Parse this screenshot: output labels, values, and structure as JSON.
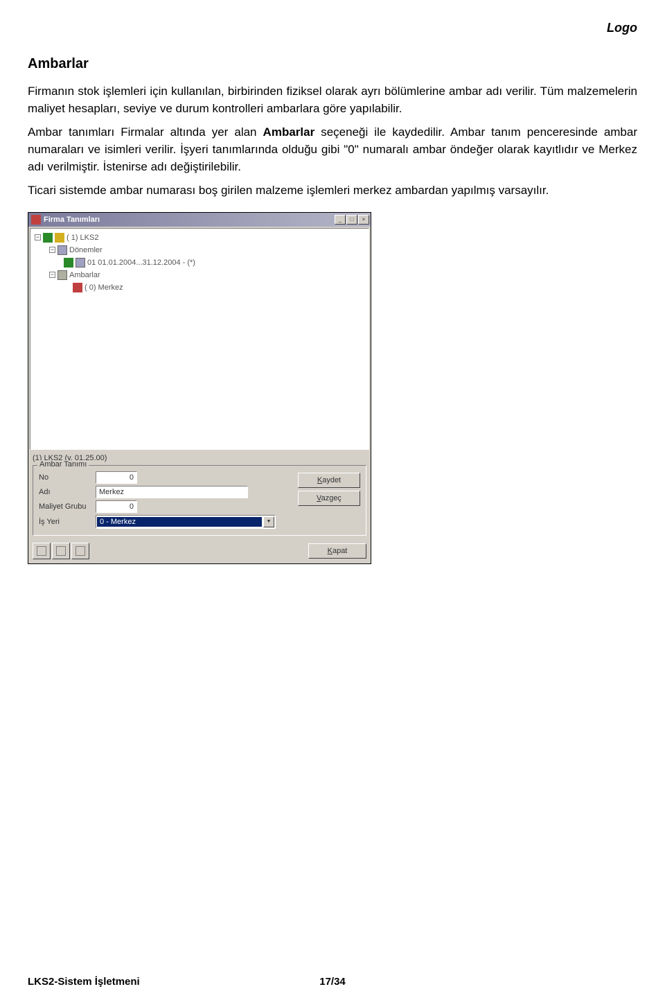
{
  "header": {
    "logo": "Logo"
  },
  "section": {
    "title": "Ambarlar",
    "p1a": "Firmanın stok işlemleri için kullanılan, birbirinden fiziksel olarak ayrı bölümlerine ambar adı verilir. Tüm malzemelerin maliyet hesapları, seviye ve durum kontrolleri ambarlara göre yapılabilir.",
    "p2a": "Ambar tanımları Firmalar altında yer alan ",
    "p2bold": "Ambarlar",
    "p2b": " seçeneği ile kaydedilir. Ambar tanım penceresinde ambar numaraları ve isimleri verilir. İşyeri tanımlarında olduğu gibi \"0\" numaralı ambar öndeğer olarak kayıtlıdır ve Merkez adı verilmiştir. İstenirse adı değiştirilebilir.",
    "p3": "Ticari sistemde ambar numarası boş girilen malzeme işlemleri merkez ambardan yapılmış varsayılır."
  },
  "window": {
    "title": "Firma Tanımları",
    "tree": {
      "root": "( 1) LKS2",
      "donemler": "Dönemler",
      "donem_item": "01 01.01.2004...31.12.2004 - (*)",
      "ambarlar": "Ambarlar",
      "ambar_item": "( 0) Merkez"
    },
    "status": "(1) LKS2 (v. 01.25.00)",
    "form": {
      "legend": "Ambar Tanımı",
      "no_label": "No",
      "no_value": "0",
      "adi_label": "Adı",
      "adi_value": "Merkez",
      "maliyet_label": "Maliyet Grubu",
      "maliyet_value": "0",
      "isyeri_label": "İş Yeri",
      "isyeri_value": "0 - Merkez",
      "kaydet": "Kaydet",
      "vazgec": "Vazgeç",
      "kapat": "Kapat"
    }
  },
  "footer": {
    "left": "LKS2-Sistem İşletmeni",
    "page": "17/34"
  }
}
